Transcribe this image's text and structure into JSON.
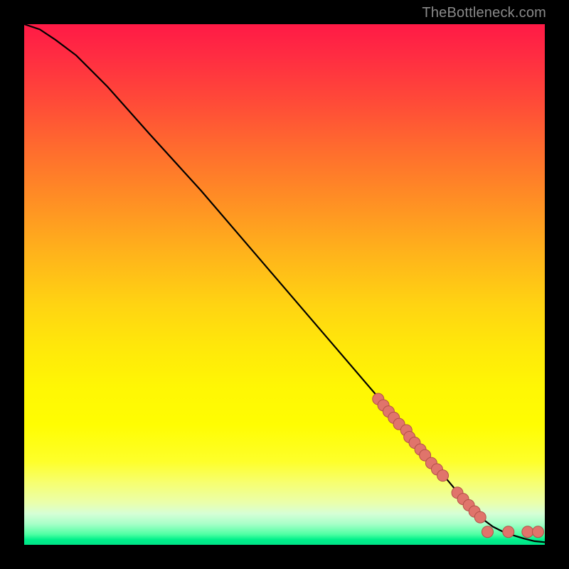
{
  "watermark": "TheBottleneck.com",
  "colors": {
    "marker_fill": "#e0746b",
    "marker_stroke": "#b35048",
    "curve_stroke": "#000000"
  },
  "chart_data": {
    "type": "line",
    "title": "",
    "xlabel": "",
    "ylabel": "",
    "xlim": [
      0,
      100
    ],
    "ylim": [
      0,
      100
    ],
    "grid": false,
    "legend": false,
    "series": [
      {
        "name": "bottleneck-curve",
        "kind": "line",
        "x": [
          0,
          3,
          6,
          10,
          16,
          24,
          34,
          46,
          58,
          70,
          80,
          85,
          88,
          90,
          92,
          94,
          96,
          98,
          100
        ],
        "y": [
          100,
          99,
          97,
          94,
          88,
          79,
          68,
          54,
          40,
          26,
          14,
          8,
          5,
          3.5,
          2.5,
          1.8,
          1.2,
          0.7,
          0.5
        ]
      },
      {
        "name": "highlight-markers",
        "kind": "scatter",
        "x": [
          68,
          69,
          70,
          71,
          72,
          73.4,
          74,
          75,
          76.1,
          77,
          78.2,
          79.3,
          80.4,
          83.2,
          84.3,
          85.4,
          86.5,
          87.6,
          89,
          93,
          96.7,
          98.7
        ],
        "y": [
          28.0,
          26.8,
          25.6,
          24.4,
          23.2,
          22.0,
          20.7,
          19.6,
          18.3,
          17.2,
          15.7,
          14.5,
          13.3,
          10.0,
          8.8,
          7.6,
          6.4,
          5.3,
          2.5,
          2.5,
          2.5,
          2.5
        ]
      }
    ]
  }
}
